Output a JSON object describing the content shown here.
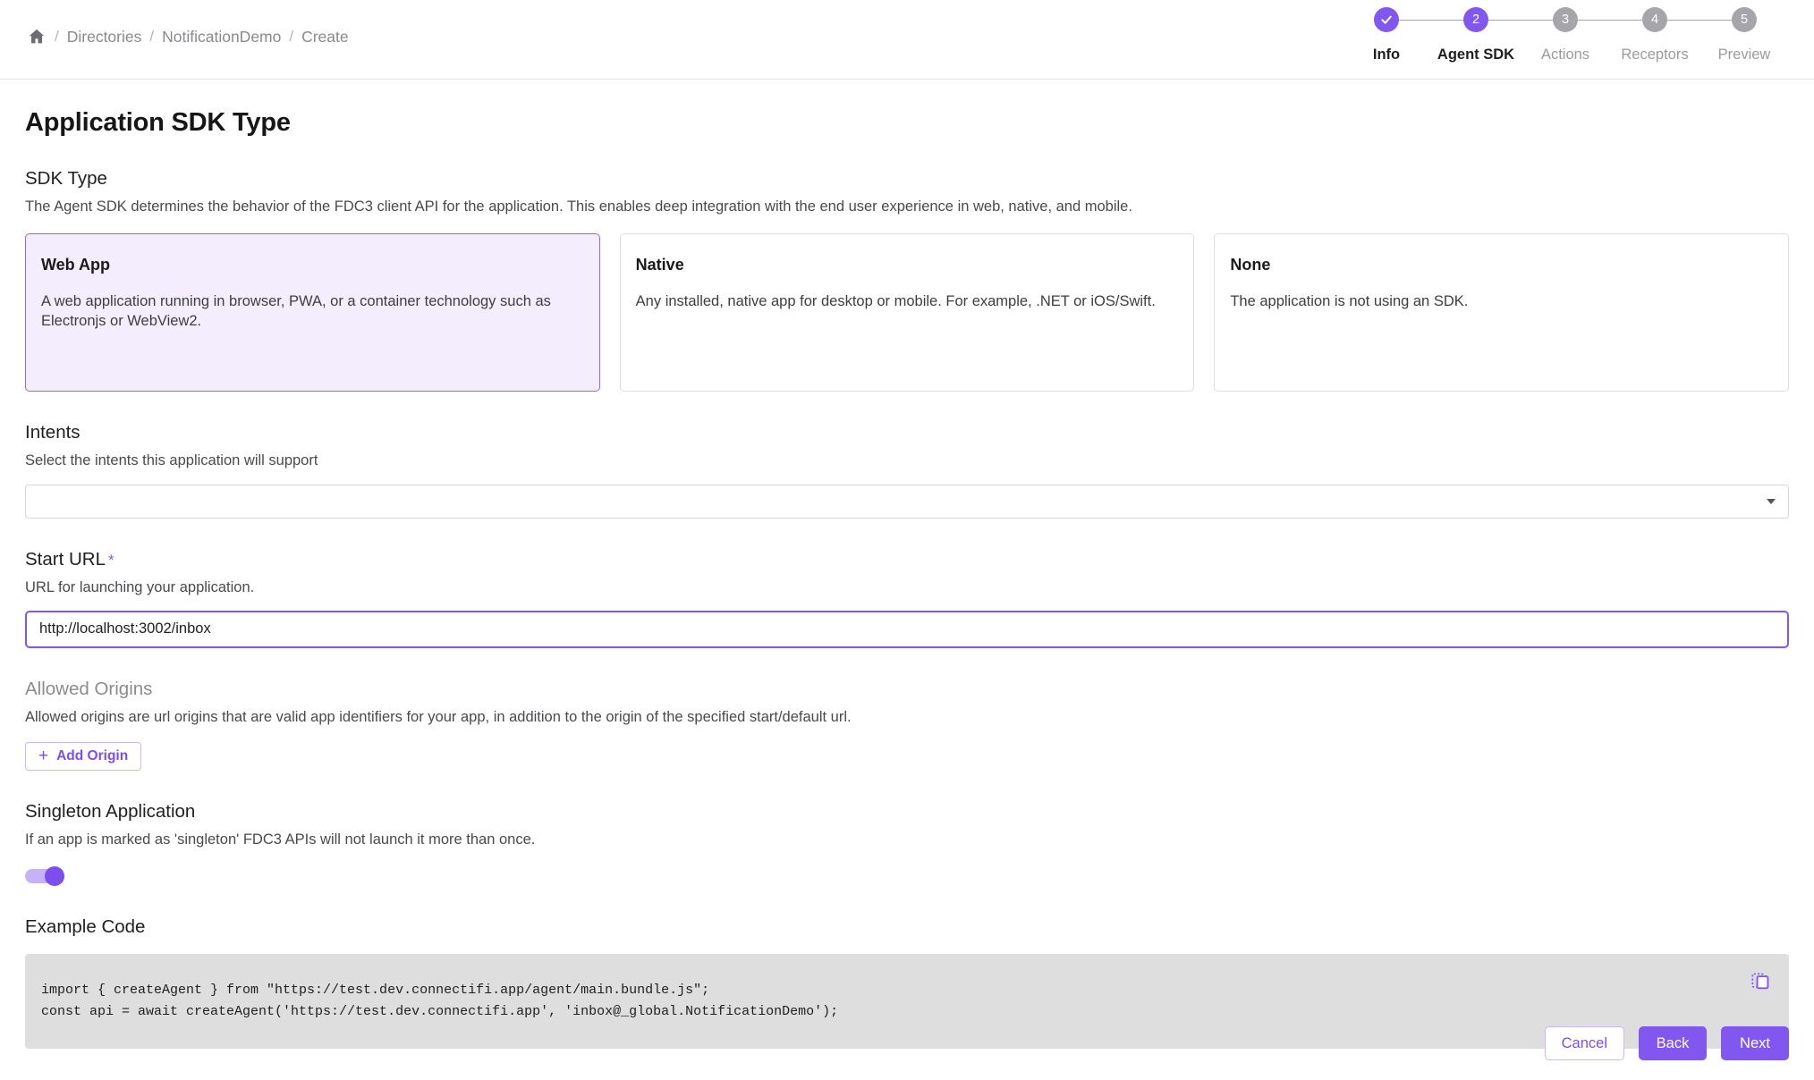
{
  "breadcrumb": {
    "home_icon": "home-icon",
    "separator": "/",
    "items": [
      {
        "label": "Directories"
      },
      {
        "label": "NotificationDemo"
      },
      {
        "label": "Create"
      }
    ]
  },
  "stepper": {
    "steps": [
      {
        "number": "1",
        "label": "Info",
        "state": "done",
        "glyph": "check-icon"
      },
      {
        "number": "2",
        "label": "Agent SDK",
        "state": "active",
        "glyph": "2"
      },
      {
        "number": "3",
        "label": "Actions",
        "state": "upcoming",
        "glyph": "3"
      },
      {
        "number": "4",
        "label": "Receptors",
        "state": "upcoming",
        "glyph": "4"
      },
      {
        "number": "5",
        "label": "Preview",
        "state": "upcoming",
        "glyph": "5"
      }
    ]
  },
  "page": {
    "title": "Application SDK Type"
  },
  "sdk_type": {
    "heading": "SDK Type",
    "description": "The Agent SDK determines the behavior of the FDC3 client API for the application. This enables deep integration with the end user experience in web, native, and mobile.",
    "cards": [
      {
        "title": "Web App",
        "description": "A web application running in browser, PWA, or a container technology such as Electronjs or WebView2.",
        "selected": true
      },
      {
        "title": "Native",
        "description": "Any installed, native app for desktop or mobile. For example, .NET or iOS/Swift.",
        "selected": false
      },
      {
        "title": "None",
        "description": "The application is not using an SDK.",
        "selected": false
      }
    ]
  },
  "intents": {
    "heading": "Intents",
    "description": "Select the intents this application will support",
    "selected_value": "",
    "caret_icon": "chevron-down-icon"
  },
  "start_url": {
    "heading": "Start URL",
    "required_marker": "*",
    "description": "URL for launching your application.",
    "value": "http://localhost:3002/inbox",
    "placeholder": ""
  },
  "allowed_origins": {
    "heading": "Allowed Origins",
    "description": "Allowed origins are url origins that are valid app identifiers for your app, in addition to the origin of the specified start/default url.",
    "add_button_label": "Add Origin",
    "add_button_icon": "plus-icon"
  },
  "singleton": {
    "heading": "Singleton Application",
    "description": "If an app is marked as 'singleton' FDC3 APIs will not launch it more than once.",
    "enabled": true
  },
  "example_code": {
    "heading": "Example Code",
    "lines": [
      "import { createAgent } from \"https://test.dev.connectifi.app/agent/main.bundle.js\";",
      "const api = await createAgent('https://test.dev.connectifi.app', 'inbox@_global.NotificationDemo');"
    ],
    "copy_icon": "copy-icon"
  },
  "footer": {
    "cancel_label": "Cancel",
    "back_label": "Back",
    "next_label": "Next"
  },
  "colors": {
    "accent": "#8257f0",
    "accent_soft": "#c5b2f7",
    "card_selected_bg": "#f3edfd",
    "muted_text": "#8a8a8e",
    "code_bg": "#dededf"
  }
}
